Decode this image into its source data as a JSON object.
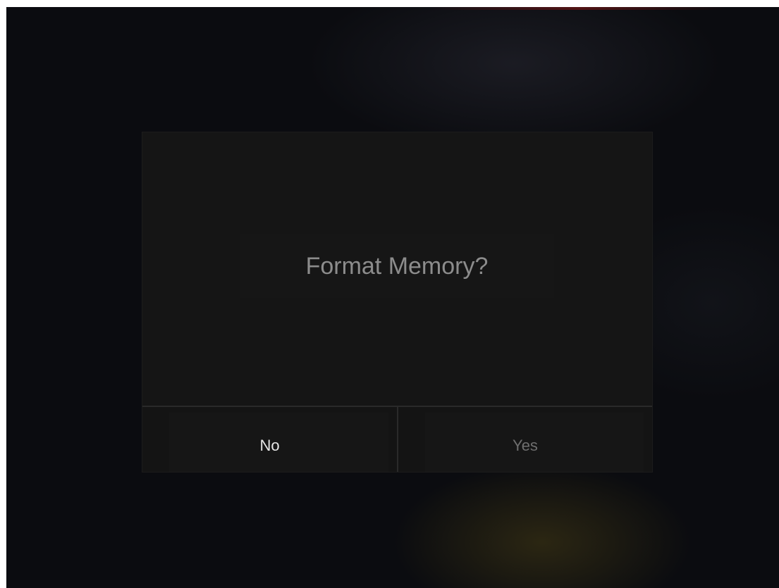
{
  "dialog": {
    "message": "Format Memory?",
    "buttons": {
      "no_label": "No",
      "yes_label": "Yes"
    }
  },
  "colors": {
    "background": "#0b0c10",
    "dialog_background": "#151515",
    "message_text": "#8c8c8c",
    "focused_button_text": "#e6e6e6",
    "unfocused_button_text": "#6e6e6e",
    "divider": "#2a2a2a"
  },
  "focus": {
    "selected_button": "No"
  }
}
